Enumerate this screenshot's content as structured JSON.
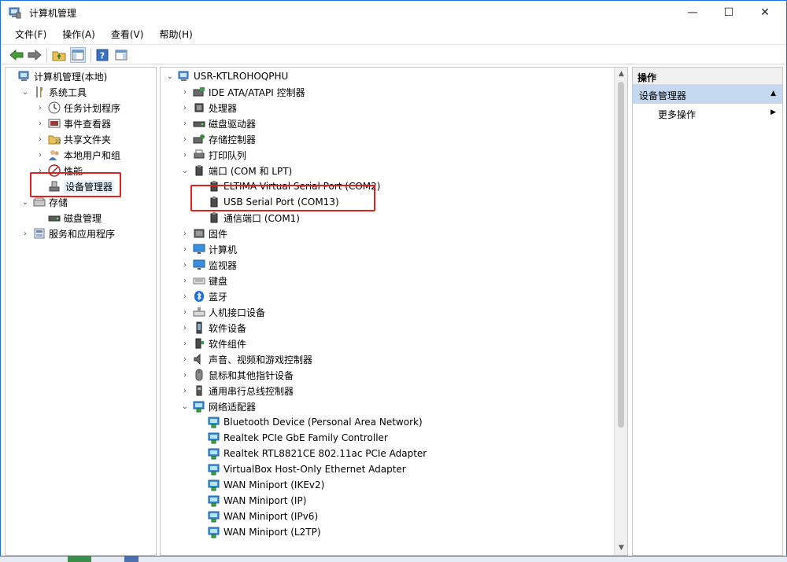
{
  "window": {
    "title": "计算机管理",
    "controls": {
      "minimize": "—",
      "maximize": "☐",
      "close": "✕"
    }
  },
  "menu": [
    "文件(F)",
    "操作(A)",
    "查看(V)",
    "帮助(H)"
  ],
  "left_tree": [
    {
      "label": "计算机管理(本地)",
      "icon": "computer-management-icon",
      "expander": "",
      "level": 0
    },
    {
      "label": "系统工具",
      "icon": "system-tools-icon",
      "expander": "expanded",
      "level": 1
    },
    {
      "label": "任务计划程序",
      "icon": "task-scheduler-icon",
      "expander": "collapsed",
      "level": 2
    },
    {
      "label": "事件查看器",
      "icon": "event-viewer-icon",
      "expander": "collapsed",
      "level": 2
    },
    {
      "label": "共享文件夹",
      "icon": "shared-folders-icon",
      "expander": "collapsed",
      "level": 2
    },
    {
      "label": "本地用户和组",
      "icon": "local-users-icon",
      "expander": "collapsed",
      "level": 2
    },
    {
      "label": "性能",
      "icon": "performance-icon",
      "expander": "collapsed",
      "level": 2
    },
    {
      "label": "设备管理器",
      "icon": "device-manager-icon",
      "expander": "",
      "level": 2,
      "selected": true
    },
    {
      "label": "存储",
      "icon": "storage-icon",
      "expander": "expanded",
      "level": 1
    },
    {
      "label": "磁盘管理",
      "icon": "disk-management-icon",
      "expander": "",
      "level": 2
    },
    {
      "label": "服务和应用程序",
      "icon": "services-apps-icon",
      "expander": "collapsed",
      "level": 1
    }
  ],
  "device_tree": [
    {
      "label": "USR-KTLROHOQPHU",
      "icon": "computer-icon",
      "expander": "expanded",
      "level": 0
    },
    {
      "label": "IDE ATA/ATAPI 控制器",
      "icon": "ide-controller-icon",
      "expander": "collapsed",
      "level": 1
    },
    {
      "label": "处理器",
      "icon": "processor-icon",
      "expander": "collapsed",
      "level": 1
    },
    {
      "label": "磁盘驱动器",
      "icon": "disk-drive-icon",
      "expander": "collapsed",
      "level": 1
    },
    {
      "label": "存储控制器",
      "icon": "storage-controller-icon",
      "expander": "collapsed",
      "level": 1
    },
    {
      "label": "打印队列",
      "icon": "print-queue-icon",
      "expander": "collapsed",
      "level": 1
    },
    {
      "label": "端口 (COM 和 LPT)",
      "icon": "port-icon",
      "expander": "expanded",
      "level": 1
    },
    {
      "label": "ELTIMA Virtual Serial Port (COM2)",
      "icon": "port-icon",
      "expander": "",
      "level": 2
    },
    {
      "label": "USB Serial Port (COM13)",
      "icon": "port-icon",
      "expander": "",
      "level": 2
    },
    {
      "label": "通信端口 (COM1)",
      "icon": "port-icon",
      "expander": "",
      "level": 2
    },
    {
      "label": "固件",
      "icon": "firmware-icon",
      "expander": "collapsed",
      "level": 1
    },
    {
      "label": "计算机",
      "icon": "monitor-icon",
      "expander": "collapsed",
      "level": 1
    },
    {
      "label": "监视器",
      "icon": "monitor-icon",
      "expander": "collapsed",
      "level": 1
    },
    {
      "label": "键盘",
      "icon": "keyboard-icon",
      "expander": "collapsed",
      "level": 1
    },
    {
      "label": "蓝牙",
      "icon": "bluetooth-icon",
      "expander": "collapsed",
      "level": 1
    },
    {
      "label": "人机接口设备",
      "icon": "hid-icon",
      "expander": "collapsed",
      "level": 1
    },
    {
      "label": "软件设备",
      "icon": "software-device-icon",
      "expander": "collapsed",
      "level": 1
    },
    {
      "label": "软件组件",
      "icon": "software-component-icon",
      "expander": "collapsed",
      "level": 1
    },
    {
      "label": "声音、视频和游戏控制器",
      "icon": "sound-icon",
      "expander": "collapsed",
      "level": 1
    },
    {
      "label": "鼠标和其他指针设备",
      "icon": "mouse-icon",
      "expander": "collapsed",
      "level": 1
    },
    {
      "label": "通用串行总线控制器",
      "icon": "usb-icon",
      "expander": "collapsed",
      "level": 1
    },
    {
      "label": "网络适配器",
      "icon": "network-adapter-icon",
      "expander": "expanded",
      "level": 1
    },
    {
      "label": "Bluetooth Device (Personal Area Network)",
      "icon": "network-adapter-icon",
      "expander": "",
      "level": 2
    },
    {
      "label": "Realtek PCIe GbE Family Controller",
      "icon": "network-adapter-icon",
      "expander": "",
      "level": 2
    },
    {
      "label": "Realtek RTL8821CE 802.11ac PCIe Adapter",
      "icon": "network-adapter-icon",
      "expander": "",
      "level": 2
    },
    {
      "label": "VirtualBox Host-Only Ethernet Adapter",
      "icon": "network-adapter-icon",
      "expander": "",
      "level": 2
    },
    {
      "label": "WAN Miniport (IKEv2)",
      "icon": "network-adapter-icon",
      "expander": "",
      "level": 2
    },
    {
      "label": "WAN Miniport (IP)",
      "icon": "network-adapter-icon",
      "expander": "",
      "level": 2
    },
    {
      "label": "WAN Miniport (IPv6)",
      "icon": "network-adapter-icon",
      "expander": "",
      "level": 2
    },
    {
      "label": "WAN Miniport (L2TP)",
      "icon": "network-adapter-icon",
      "expander": "",
      "level": 2
    }
  ],
  "actions": {
    "header": "操作",
    "section": "设备管理器",
    "more": "更多操作"
  },
  "colors": {
    "highlight": "#e02020",
    "section_bg": "#c4d9ef",
    "selection_bg": "#e5f1fb"
  }
}
